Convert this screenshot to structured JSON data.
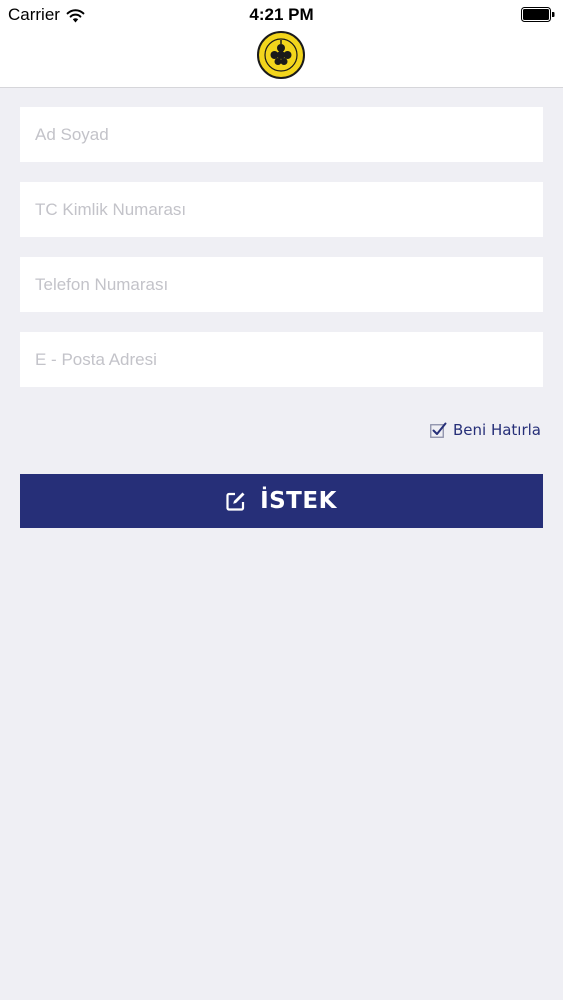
{
  "status_bar": {
    "carrier": "Carrier",
    "time": "4:21 PM"
  },
  "header": {
    "logo_icon": "municipality-logo-icon"
  },
  "form": {
    "fields": [
      {
        "placeholder": "Ad Soyad",
        "value": ""
      },
      {
        "placeholder": "TC Kimlik Numarası",
        "value": ""
      },
      {
        "placeholder": "Telefon Numarası",
        "value": ""
      },
      {
        "placeholder": "E - Posta Adresi",
        "value": ""
      }
    ],
    "remember_label": "Beni Hatırla",
    "remember_checked": true,
    "submit_label": "İSTEK"
  },
  "colors": {
    "primary": "#262f78",
    "background": "#efeff4",
    "logo_yellow": "#f2d51c"
  }
}
